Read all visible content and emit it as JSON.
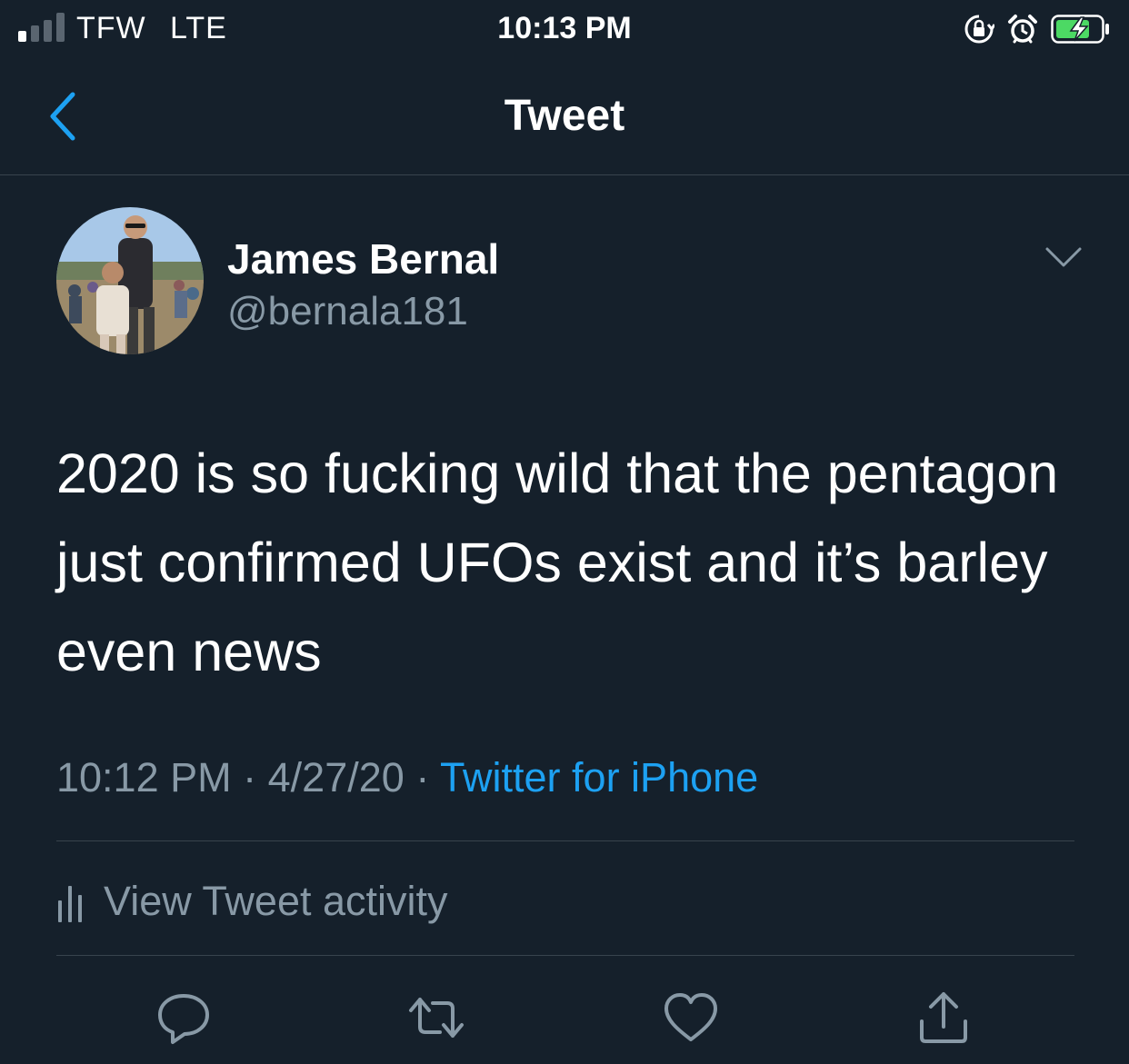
{
  "status_bar": {
    "carrier": "TFW",
    "network": "LTE",
    "time": "10:13 PM",
    "battery_charging": true,
    "icons": [
      "signal-icon",
      "orientation-lock-icon",
      "alarm-icon",
      "battery-icon"
    ]
  },
  "nav": {
    "title": "Tweet",
    "back_icon": "chevron-left-icon"
  },
  "tweet": {
    "author": {
      "display_name": "James Bernal",
      "handle": "@bernala181"
    },
    "text": "2020 is so fucking wild that the pentagon just confirmed UFOs exist and it’s barley even news",
    "time": "10:12 PM",
    "date": "4/27/20",
    "separator": "·",
    "source": "Twitter for iPhone"
  },
  "activity": {
    "label": "View Tweet activity",
    "icon": "bar-chart-icon"
  },
  "actions": [
    "reply-icon",
    "retweet-icon",
    "like-icon",
    "share-icon"
  ],
  "colors": {
    "background": "#15202b",
    "accent": "#1da1f2",
    "secondary_text": "#8899a6",
    "divider": "#38444d",
    "battery_green": "#4cd964"
  }
}
